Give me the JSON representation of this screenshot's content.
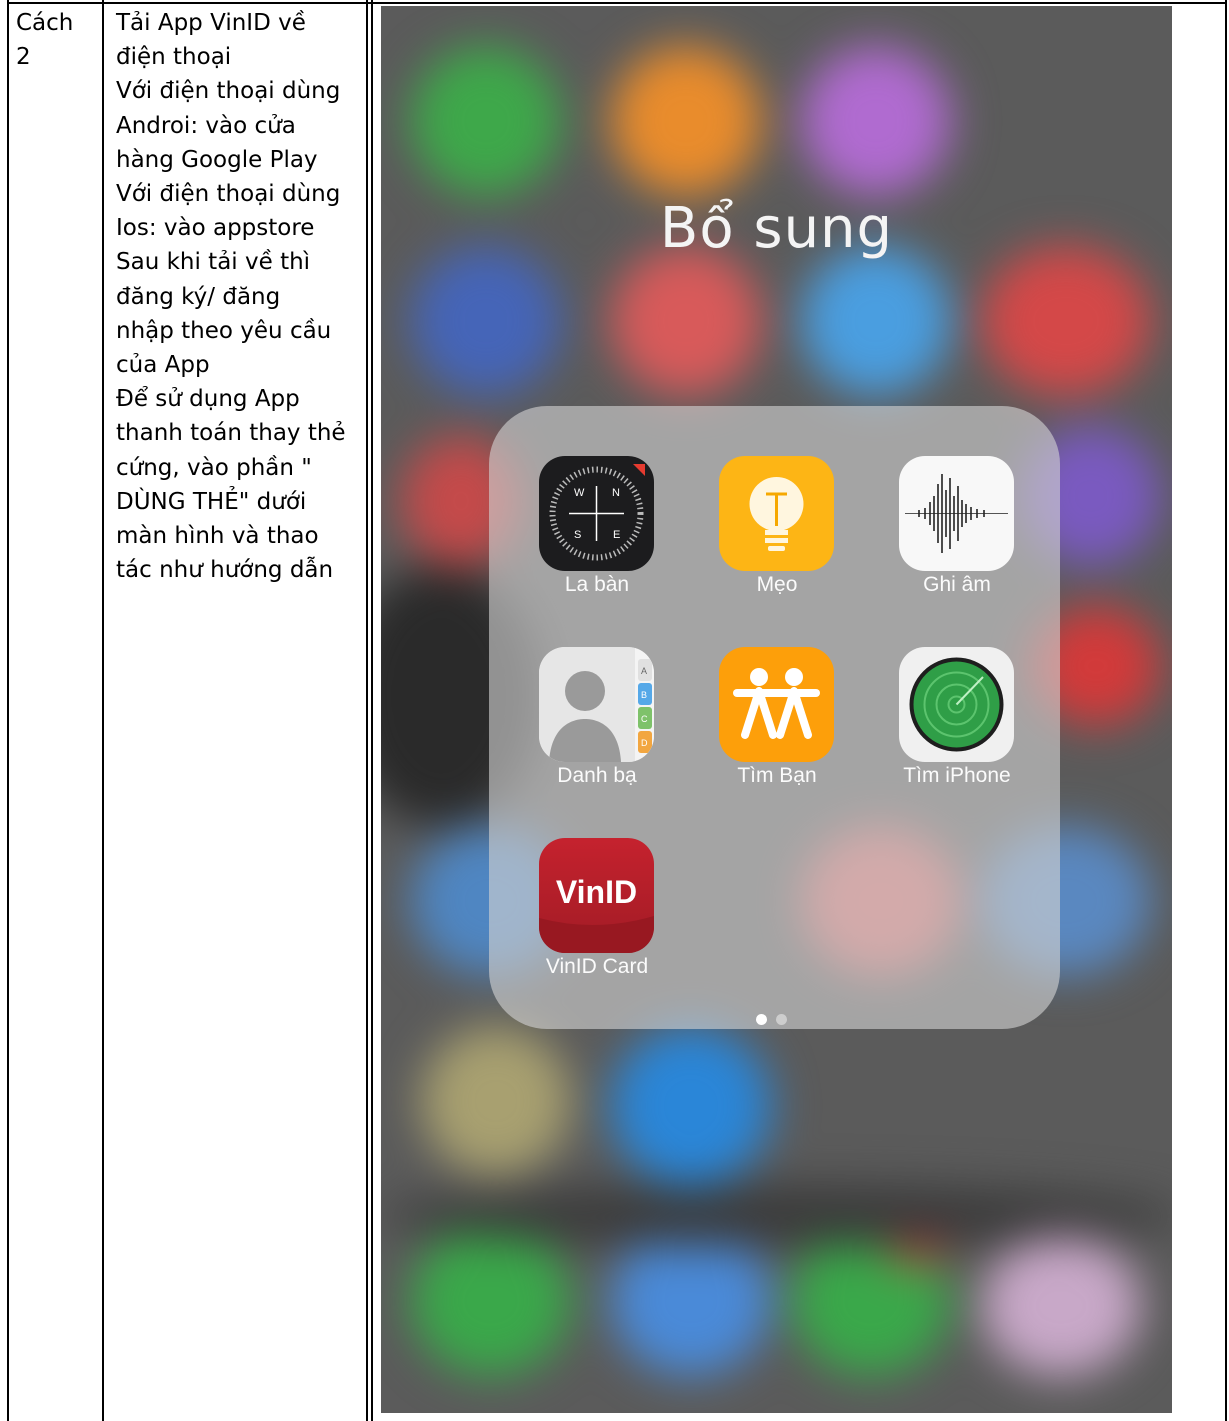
{
  "table": {
    "method_label": [
      "Cách",
      "2"
    ],
    "instructions": [
      "Tải App VinID về",
      "điện thoại",
      "Với điện thoại dùng",
      "Androi: vào cửa",
      "hàng Google Play",
      "Với điện thoại dùng",
      "Ios: vào appstore",
      "Sau khi tải về thì",
      "đăng ký/ đăng",
      "nhập theo yêu cầu",
      "của App",
      "Để sử dụng App",
      "thanh toán thay thẻ",
      "cứng, vào phần \"",
      "DÙNG THẺ\" dưới",
      "màn hình và thao",
      "tác như hướng dẫn"
    ]
  },
  "phone": {
    "folder_title": "Bổ sung",
    "apps": [
      {
        "label": "La bàn",
        "icon": "compass-icon"
      },
      {
        "label": "Mẹo",
        "icon": "lightbulb-icon"
      },
      {
        "label": "Ghi âm",
        "icon": "voice-memo-icon"
      },
      {
        "label": "Danh bạ",
        "icon": "contacts-icon"
      },
      {
        "label": "Tìm Bạn",
        "icon": "find-friends-icon"
      },
      {
        "label": "Tìm iPhone",
        "icon": "find-iphone-icon"
      },
      {
        "label": "VinID Card",
        "icon": "vinid-icon"
      }
    ],
    "vinid_logo_text": "VinID",
    "compass_letters": [
      "W",
      "N",
      "S",
      "E"
    ],
    "contacts_tabs": [
      "A",
      "B",
      "C",
      "D"
    ],
    "page_indicator": {
      "pages": 2,
      "current": 1
    },
    "colors": {
      "compass_bg": "#1c1c1e",
      "tips_bg": "#fdb515",
      "find_friends_bg": "#fd9f0a",
      "find_iphone_green": "#2f9e47",
      "vinid_red": "#b4202b",
      "folder_label": "#fbfbfb"
    }
  }
}
